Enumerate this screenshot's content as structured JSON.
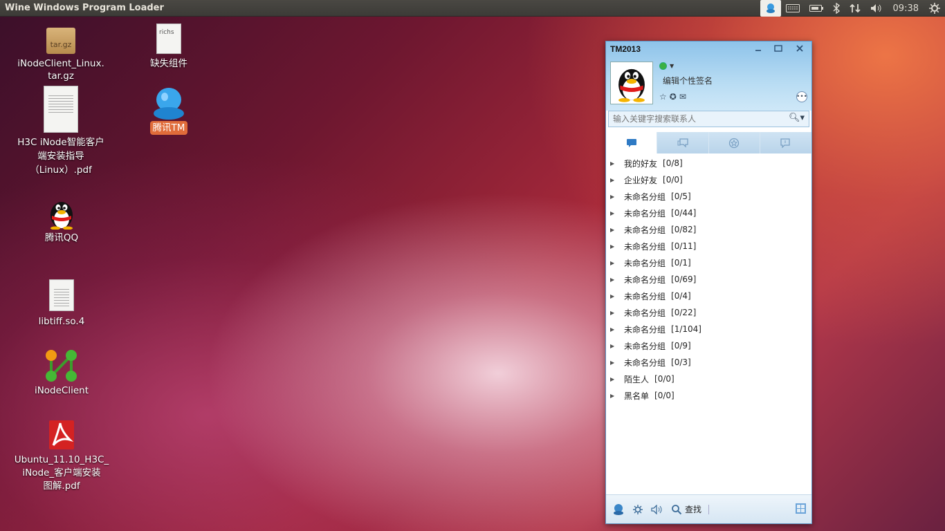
{
  "panel": {
    "app_title": "Wine Windows Program Loader",
    "clock": "09:38",
    "indicators": [
      "tm-tray-icon",
      "keyboard-icon",
      "battery-icon",
      "bluetooth-icon",
      "network-icon",
      "volume-icon",
      "session-gear-icon"
    ]
  },
  "desktop": {
    "icons": [
      {
        "name": "iNodeClient_Linux.\ntar.gz",
        "badge": "tar.gz"
      },
      {
        "name": "缺失组件",
        "badge": "richs"
      },
      {
        "name": "H3C iNode智能客户\n端安装指导\n（Linux）.pdf"
      },
      {
        "name": "腾讯TM"
      },
      {
        "name": "腾讯QQ"
      },
      {
        "name": "libtiff.so.4"
      },
      {
        "name": "iNodeClient"
      },
      {
        "name": "Ubuntu_11.10_H3C_\niNode_客户端安装\n图解.pdf"
      }
    ]
  },
  "tm": {
    "title": "TM2013",
    "signature": "编辑个性签名",
    "search_placeholder": "输入关键字搜索联系人",
    "tabs": [
      "chat",
      "groups",
      "qzone",
      "recent"
    ],
    "groups": [
      {
        "name": "我的好友",
        "count": "[0/8]"
      },
      {
        "name": "企业好友",
        "count": "[0/0]"
      },
      {
        "name": "未命名分组",
        "count": "[0/5]"
      },
      {
        "name": "未命名分组",
        "count": "[0/44]"
      },
      {
        "name": "未命名分组",
        "count": "[0/82]"
      },
      {
        "name": "未命名分组",
        "count": "[0/11]"
      },
      {
        "name": "未命名分组",
        "count": "[0/1]"
      },
      {
        "name": "未命名分组",
        "count": "[0/69]"
      },
      {
        "name": "未命名分组",
        "count": "[0/4]"
      },
      {
        "name": "未命名分组",
        "count": "[0/22]"
      },
      {
        "name": "未命名分组",
        "count": "[1/104]"
      },
      {
        "name": "未命名分组",
        "count": "[0/9]"
      },
      {
        "name": "未命名分组",
        "count": "[0/3]"
      },
      {
        "name": "陌生人",
        "count": "[0/0]"
      },
      {
        "name": "黑名单",
        "count": "[0/0]"
      }
    ],
    "bottom": {
      "find_label": "查找"
    }
  }
}
